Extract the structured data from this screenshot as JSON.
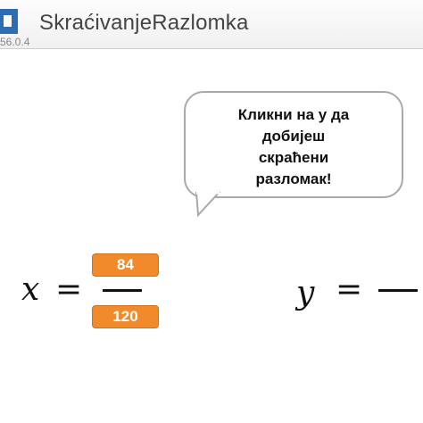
{
  "window": {
    "title": "SkraćivanjeRazlomka",
    "version": "56.0.4"
  },
  "speech_bubble": {
    "lines": [
      "Кликни на y да",
      "добијеш",
      "скраћени",
      "разломак!"
    ]
  },
  "left_fraction": {
    "variable": "x",
    "equals": "=",
    "numerator": "84",
    "denominator": "120"
  },
  "right_fraction": {
    "variable": "y",
    "equals": "="
  },
  "colors": {
    "slot_orange": "#f08a2a",
    "bubble_border": "#a9a9a9",
    "icon_blue": "#2f6db3"
  }
}
